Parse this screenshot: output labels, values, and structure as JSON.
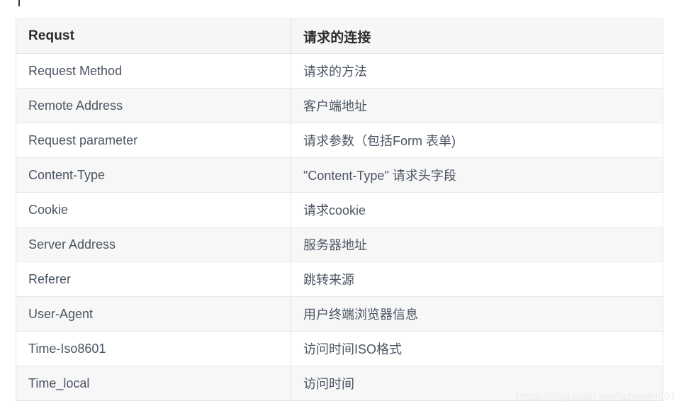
{
  "table": {
    "headers": {
      "key": "Requst",
      "value": "请求的连接"
    },
    "rows": [
      {
        "key": "Request Method",
        "value": "请求的方法"
      },
      {
        "key": "Remote Address",
        "value": "客户端地址"
      },
      {
        "key": "Request parameter",
        "value": "请求参数（包括Form 表单)"
      },
      {
        "key": "Content-Type",
        "value": "\"Content-Type\" 请求头字段"
      },
      {
        "key": "Cookie",
        "value": "请求cookie"
      },
      {
        "key": "Server Address",
        "value": "服务器地址"
      },
      {
        "key": "Referer",
        "value": "跳转来源"
      },
      {
        "key": "User-Agent",
        "value": "用户终端浏览器信息"
      },
      {
        "key": "Time-Iso8601",
        "value": "访问时间ISO格式"
      },
      {
        "key": "Time_local",
        "value": "访问时间"
      }
    ]
  },
  "watermark": {
    "text": "https://blog.csdn.net/lazyman001"
  },
  "colors": {
    "header_bg": "#f6f6f6",
    "stripe_bg": "#f7f7f7",
    "row_bg": "#ffffff",
    "border": "#e4e4e4",
    "header_text": "#2b2b2b",
    "body_text": "#4b5563",
    "watermark_text": "#ececec"
  }
}
